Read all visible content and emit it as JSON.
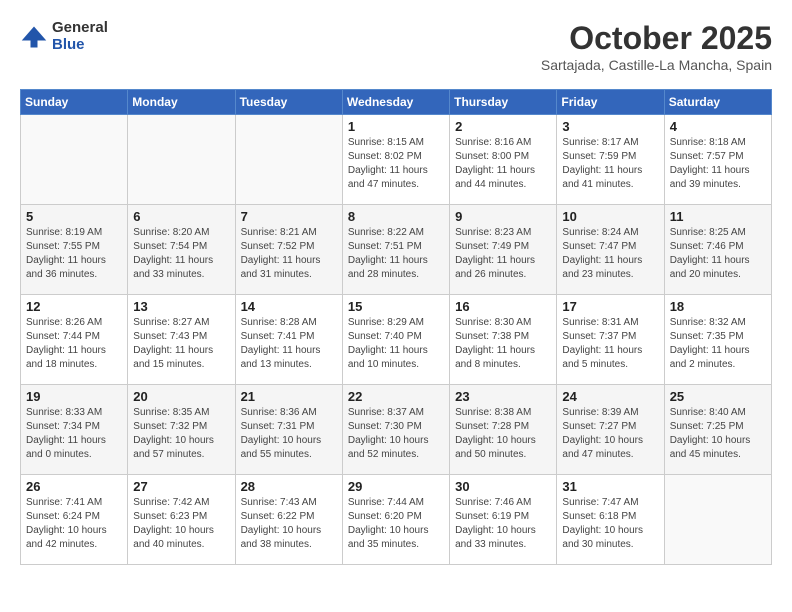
{
  "header": {
    "logo_general": "General",
    "logo_blue": "Blue",
    "month_title": "October 2025",
    "location": "Sartajada, Castille-La Mancha, Spain"
  },
  "weekdays": [
    "Sunday",
    "Monday",
    "Tuesday",
    "Wednesday",
    "Thursday",
    "Friday",
    "Saturday"
  ],
  "weeks": [
    [
      null,
      null,
      null,
      {
        "day": 1,
        "sunrise": "8:15 AM",
        "sunset": "8:02 PM",
        "daylight": "11 hours and 47 minutes."
      },
      {
        "day": 2,
        "sunrise": "8:16 AM",
        "sunset": "8:00 PM",
        "daylight": "11 hours and 44 minutes."
      },
      {
        "day": 3,
        "sunrise": "8:17 AM",
        "sunset": "7:59 PM",
        "daylight": "11 hours and 41 minutes."
      },
      {
        "day": 4,
        "sunrise": "8:18 AM",
        "sunset": "7:57 PM",
        "daylight": "11 hours and 39 minutes."
      }
    ],
    [
      {
        "day": 5,
        "sunrise": "8:19 AM",
        "sunset": "7:55 PM",
        "daylight": "11 hours and 36 minutes."
      },
      {
        "day": 6,
        "sunrise": "8:20 AM",
        "sunset": "7:54 PM",
        "daylight": "11 hours and 33 minutes."
      },
      {
        "day": 7,
        "sunrise": "8:21 AM",
        "sunset": "7:52 PM",
        "daylight": "11 hours and 31 minutes."
      },
      {
        "day": 8,
        "sunrise": "8:22 AM",
        "sunset": "7:51 PM",
        "daylight": "11 hours and 28 minutes."
      },
      {
        "day": 9,
        "sunrise": "8:23 AM",
        "sunset": "7:49 PM",
        "daylight": "11 hours and 26 minutes."
      },
      {
        "day": 10,
        "sunrise": "8:24 AM",
        "sunset": "7:47 PM",
        "daylight": "11 hours and 23 minutes."
      },
      {
        "day": 11,
        "sunrise": "8:25 AM",
        "sunset": "7:46 PM",
        "daylight": "11 hours and 20 minutes."
      }
    ],
    [
      {
        "day": 12,
        "sunrise": "8:26 AM",
        "sunset": "7:44 PM",
        "daylight": "11 hours and 18 minutes."
      },
      {
        "day": 13,
        "sunrise": "8:27 AM",
        "sunset": "7:43 PM",
        "daylight": "11 hours and 15 minutes."
      },
      {
        "day": 14,
        "sunrise": "8:28 AM",
        "sunset": "7:41 PM",
        "daylight": "11 hours and 13 minutes."
      },
      {
        "day": 15,
        "sunrise": "8:29 AM",
        "sunset": "7:40 PM",
        "daylight": "11 hours and 10 minutes."
      },
      {
        "day": 16,
        "sunrise": "8:30 AM",
        "sunset": "7:38 PM",
        "daylight": "11 hours and 8 minutes."
      },
      {
        "day": 17,
        "sunrise": "8:31 AM",
        "sunset": "7:37 PM",
        "daylight": "11 hours and 5 minutes."
      },
      {
        "day": 18,
        "sunrise": "8:32 AM",
        "sunset": "7:35 PM",
        "daylight": "11 hours and 2 minutes."
      }
    ],
    [
      {
        "day": 19,
        "sunrise": "8:33 AM",
        "sunset": "7:34 PM",
        "daylight": "11 hours and 0 minutes."
      },
      {
        "day": 20,
        "sunrise": "8:35 AM",
        "sunset": "7:32 PM",
        "daylight": "10 hours and 57 minutes."
      },
      {
        "day": 21,
        "sunrise": "8:36 AM",
        "sunset": "7:31 PM",
        "daylight": "10 hours and 55 minutes."
      },
      {
        "day": 22,
        "sunrise": "8:37 AM",
        "sunset": "7:30 PM",
        "daylight": "10 hours and 52 minutes."
      },
      {
        "day": 23,
        "sunrise": "8:38 AM",
        "sunset": "7:28 PM",
        "daylight": "10 hours and 50 minutes."
      },
      {
        "day": 24,
        "sunrise": "8:39 AM",
        "sunset": "7:27 PM",
        "daylight": "10 hours and 47 minutes."
      },
      {
        "day": 25,
        "sunrise": "8:40 AM",
        "sunset": "7:25 PM",
        "daylight": "10 hours and 45 minutes."
      }
    ],
    [
      {
        "day": 26,
        "sunrise": "7:41 AM",
        "sunset": "6:24 PM",
        "daylight": "10 hours and 42 minutes."
      },
      {
        "day": 27,
        "sunrise": "7:42 AM",
        "sunset": "6:23 PM",
        "daylight": "10 hours and 40 minutes."
      },
      {
        "day": 28,
        "sunrise": "7:43 AM",
        "sunset": "6:22 PM",
        "daylight": "10 hours and 38 minutes."
      },
      {
        "day": 29,
        "sunrise": "7:44 AM",
        "sunset": "6:20 PM",
        "daylight": "10 hours and 35 minutes."
      },
      {
        "day": 30,
        "sunrise": "7:46 AM",
        "sunset": "6:19 PM",
        "daylight": "10 hours and 33 minutes."
      },
      {
        "day": 31,
        "sunrise": "7:47 AM",
        "sunset": "6:18 PM",
        "daylight": "10 hours and 30 minutes."
      },
      null
    ]
  ]
}
